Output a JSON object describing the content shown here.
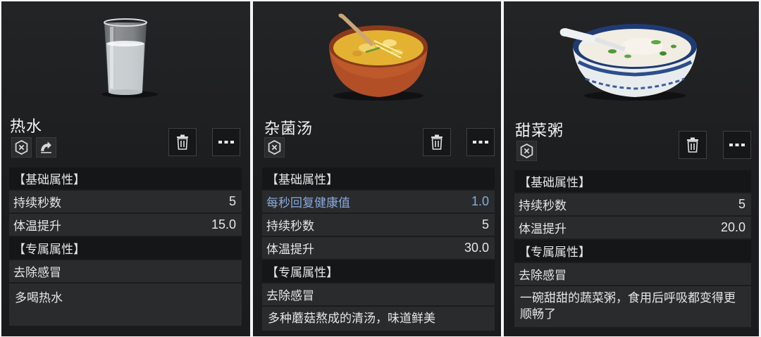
{
  "cards": [
    {
      "name": "热水",
      "image_icon": "glass-of-water",
      "badges": [
        "shield-x-icon",
        "cure-cold-icon"
      ],
      "section_basic": "【基础属性】",
      "basic": [
        {
          "label": "持续秒数",
          "value": "5"
        },
        {
          "label": "体温提升",
          "value": "15.0"
        }
      ],
      "section_special": "【专属属性】",
      "special": "去除感冒",
      "description": "多喝热水"
    },
    {
      "name": "杂菌汤",
      "image_icon": "mushroom-soup-bowl",
      "badges": [
        "shield-x-icon"
      ],
      "section_basic": "【基础属性】",
      "basic": [
        {
          "label": "每秒回复健康值",
          "value": "1.0",
          "highlight": true
        },
        {
          "label": "持续秒数",
          "value": "5"
        },
        {
          "label": "体温提升",
          "value": "30.0"
        }
      ],
      "section_special": "【专属属性】",
      "special": "去除感冒",
      "description": "多种蘑菇熬成的清汤，味道鲜美"
    },
    {
      "name": "甜菜粥",
      "image_icon": "vegetable-porridge-bowl",
      "badges": [
        "shield-x-icon"
      ],
      "section_basic": "【基础属性】",
      "basic": [
        {
          "label": "持续秒数",
          "value": "5"
        },
        {
          "label": "体温提升",
          "value": "20.0"
        }
      ],
      "section_special": "【专属属性】",
      "special": "去除感冒",
      "description": "一碗甜甜的蔬菜粥，食用后呼吸都变得更顺畅了"
    }
  ],
  "colors": {
    "panel_bg": "#1c1d1f",
    "row_bg": "#2a2b2d",
    "header_bg": "#151617",
    "highlight_text": "#8aa9de"
  }
}
